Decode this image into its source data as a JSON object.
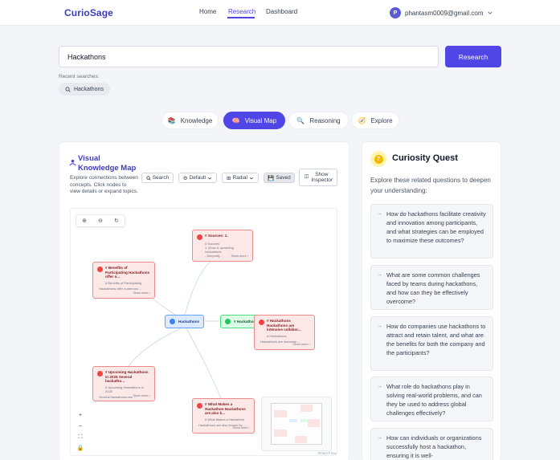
{
  "app": {
    "logo": "CurioSage",
    "nav": [
      {
        "label": "Home"
      },
      {
        "label": "Research",
        "active": true
      },
      {
        "label": "Dashboard"
      }
    ],
    "user": {
      "initial": "P",
      "email": "phantasm0009@gmail.com"
    }
  },
  "search": {
    "value": "Hackathons",
    "button_label": "Research",
    "recent_label": "Recent searches:",
    "recent": [
      "Hackathons"
    ]
  },
  "tabs": [
    {
      "label": "Knowledge",
      "icon": "book-stack-icon"
    },
    {
      "label": "Visual Map",
      "icon": "brain-icon",
      "active": true
    },
    {
      "label": "Reasoning",
      "icon": "magnifier-icon"
    },
    {
      "label": "Explore",
      "icon": "compass-icon"
    }
  ],
  "visual_map": {
    "title": "Visual Knowledge Map",
    "description": "Explore connections between concepts. Click nodes to view details or expand topics.",
    "toolbar": {
      "search": "Search",
      "layout": "Default",
      "mode": "Radial",
      "saved": "Saved",
      "inspector": "Show Inspector"
    },
    "nodes": {
      "center": "Hackathons",
      "green": "# Hackathons",
      "sources": {
        "title": "# Sources: 1.",
        "lines": "# Sources\n1. [How & upcoming hackathons\n- Devpost]...",
        "more": "Show more ›"
      },
      "benefits": {
        "title": "# Benefits of Participating Hackathons offer n...",
        "sub": "# Benefits of Participating",
        "body": "Hackathons offer numerous ...",
        "more": "Show more ›"
      },
      "intensive": {
        "title": "# Hackathons Hackathons are intensive collabor...",
        "sub": "# Hackathons",
        "body": "Hackathons are intensive ...",
        "more": "Show more ›"
      },
      "upcoming": {
        "title": "# Upcoming Hackathons in 2025 Several hackatho...",
        "sub": "# Upcoming Hackathons in 2025",
        "body": "Several hackathons are ...",
        "more": "Show more ›"
      },
      "what": {
        "title": "# What Makes a Hackathon Hackathons are also k...",
        "sub": "# What Makes a Hackathon",
        "body": "Hackathons are also known by ...",
        "more": "Show more ›"
      }
    },
    "credit": "React Flow"
  },
  "quest": {
    "badge": "?",
    "title": "Curiosity Quest",
    "description": "Explore these related questions to deepen your understanding:",
    "questions": [
      "How do hackathons facilitate creativity and innovation among participants, and what strategies can be employed to maximize these outcomes?",
      "What are some common challenges faced by teams during hackathons, and how can they be effectively overcome?",
      "How do companies use hackathons to attract and retain talent, and what are the benefits for both the company and the participants?",
      "What role do hackathons play in solving real-world problems, and can they be used to address global challenges effectively?",
      "How can individuals or organizations successfully host a hackathon, ensuring it is well-"
    ]
  },
  "colors": {
    "accent": "#4f46e5",
    "node_red": "#ef4444",
    "node_blue": "#3b82f6",
    "node_green": "#22c55e"
  }
}
